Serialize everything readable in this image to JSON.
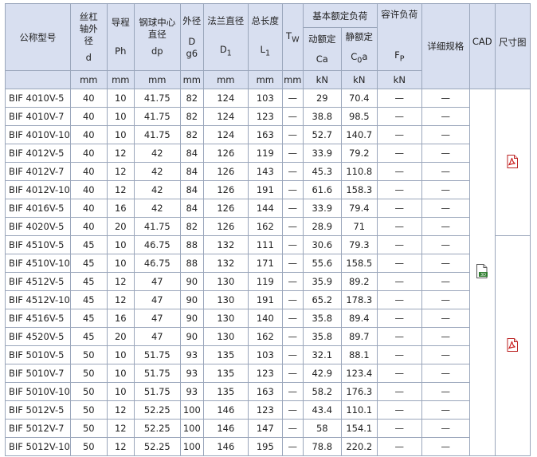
{
  "headers": {
    "model": "公称型号",
    "shaft_dia": "丝杠轴外径",
    "shaft_dia_sym": "d",
    "lead": "导程",
    "lead_sym": "Ph",
    "ball_center": "钢球中心直径",
    "ball_center_sym": "dp",
    "outer_dia": "外径",
    "outer_dia_sym_1": "D",
    "outer_dia_sym_2": "g6",
    "flange_dia": "法兰直径",
    "flange_dia_sym": "D",
    "flange_dia_sub": "1",
    "length": "总长度",
    "length_sym": "L",
    "length_sub": "1",
    "tw_sym": "T",
    "tw_sub": "W",
    "basic_load": "基本额定负荷",
    "dynamic": "动额定",
    "dynamic_sym": "Ca",
    "static": "静额定",
    "static_sym": "C",
    "static_sub": "0",
    "static_sym_tail": "a",
    "allow_load": "容许负荷",
    "allow_sym": "F",
    "allow_sub": "P",
    "detail": "详细规格",
    "cad": "CAD",
    "drawing": "尺寸图"
  },
  "units": [
    "mm",
    "mm",
    "mm",
    "mm",
    "mm",
    "mm",
    "mm",
    "kN",
    "kN",
    "kN"
  ],
  "rows": [
    {
      "model": "BIF 4010V-5",
      "d": "40",
      "ph": "10",
      "dp": "41.75",
      "D": "82",
      "D1": "124",
      "L1": "103",
      "tw": "—",
      "ca": "29",
      "c0a": "70.4",
      "fp": "—",
      "detail": "—"
    },
    {
      "model": "BIF 4010V-7",
      "d": "40",
      "ph": "10",
      "dp": "41.75",
      "D": "82",
      "D1": "124",
      "L1": "123",
      "tw": "—",
      "ca": "38.8",
      "c0a": "98.5",
      "fp": "—",
      "detail": "—"
    },
    {
      "model": "BIF 4010V-10",
      "d": "40",
      "ph": "10",
      "dp": "41.75",
      "D": "82",
      "D1": "124",
      "L1": "163",
      "tw": "—",
      "ca": "52.7",
      "c0a": "140.7",
      "fp": "—",
      "detail": "—"
    },
    {
      "model": "BIF 4012V-5",
      "d": "40",
      "ph": "12",
      "dp": "42",
      "D": "84",
      "D1": "126",
      "L1": "119",
      "tw": "—",
      "ca": "33.9",
      "c0a": "79.2",
      "fp": "—",
      "detail": "—"
    },
    {
      "model": "BIF 4012V-7",
      "d": "40",
      "ph": "12",
      "dp": "42",
      "D": "84",
      "D1": "126",
      "L1": "143",
      "tw": "—",
      "ca": "45.3",
      "c0a": "110.8",
      "fp": "—",
      "detail": "—"
    },
    {
      "model": "BIF 4012V-10",
      "d": "40",
      "ph": "12",
      "dp": "42",
      "D": "84",
      "D1": "126",
      "L1": "191",
      "tw": "—",
      "ca": "61.6",
      "c0a": "158.3",
      "fp": "—",
      "detail": "—"
    },
    {
      "model": "BIF 4016V-5",
      "d": "40",
      "ph": "16",
      "dp": "42",
      "D": "84",
      "D1": "126",
      "L1": "144",
      "tw": "—",
      "ca": "33.9",
      "c0a": "79.4",
      "fp": "—",
      "detail": "—"
    },
    {
      "model": "BIF 4020V-5",
      "d": "40",
      "ph": "20",
      "dp": "41.75",
      "D": "82",
      "D1": "126",
      "L1": "162",
      "tw": "—",
      "ca": "28.9",
      "c0a": "71",
      "fp": "—",
      "detail": "—"
    },
    {
      "model": "BIF 4510V-5",
      "d": "45",
      "ph": "10",
      "dp": "46.75",
      "D": "88",
      "D1": "132",
      "L1": "111",
      "tw": "—",
      "ca": "30.6",
      "c0a": "79.3",
      "fp": "—",
      "detail": "—"
    },
    {
      "model": "BIF 4510V-10",
      "d": "45",
      "ph": "10",
      "dp": "46.75",
      "D": "88",
      "D1": "132",
      "L1": "171",
      "tw": "—",
      "ca": "55.6",
      "c0a": "158.5",
      "fp": "—",
      "detail": "—"
    },
    {
      "model": "BIF 4512V-5",
      "d": "45",
      "ph": "12",
      "dp": "47",
      "D": "90",
      "D1": "130",
      "L1": "119",
      "tw": "—",
      "ca": "35.9",
      "c0a": "89.2",
      "fp": "—",
      "detail": "—"
    },
    {
      "model": "BIF 4512V-10",
      "d": "45",
      "ph": "12",
      "dp": "47",
      "D": "90",
      "D1": "130",
      "L1": "191",
      "tw": "—",
      "ca": "65.2",
      "c0a": "178.3",
      "fp": "—",
      "detail": "—"
    },
    {
      "model": "BIF 4516V-5",
      "d": "45",
      "ph": "16",
      "dp": "47",
      "D": "90",
      "D1": "130",
      "L1": "140",
      "tw": "—",
      "ca": "35.8",
      "c0a": "89.4",
      "fp": "—",
      "detail": "—"
    },
    {
      "model": "BIF 4520V-5",
      "d": "45",
      "ph": "20",
      "dp": "47",
      "D": "90",
      "D1": "130",
      "L1": "162",
      "tw": "—",
      "ca": "35.8",
      "c0a": "89.7",
      "fp": "—",
      "detail": "—"
    },
    {
      "model": "BIF 5010V-5",
      "d": "50",
      "ph": "10",
      "dp": "51.75",
      "D": "93",
      "D1": "135",
      "L1": "103",
      "tw": "—",
      "ca": "32.1",
      "c0a": "88.1",
      "fp": "—",
      "detail": "—"
    },
    {
      "model": "BIF 5010V-7",
      "d": "50",
      "ph": "10",
      "dp": "51.75",
      "D": "93",
      "D1": "135",
      "L1": "123",
      "tw": "—",
      "ca": "42.9",
      "c0a": "123.4",
      "fp": "—",
      "detail": "—"
    },
    {
      "model": "BIF 5010V-10",
      "d": "50",
      "ph": "10",
      "dp": "51.75",
      "D": "93",
      "D1": "135",
      "L1": "163",
      "tw": "—",
      "ca": "58.2",
      "c0a": "176.3",
      "fp": "—",
      "detail": "—"
    },
    {
      "model": "BIF 5012V-5",
      "d": "50",
      "ph": "12",
      "dp": "52.25",
      "D": "100",
      "D1": "146",
      "L1": "123",
      "tw": "—",
      "ca": "43.4",
      "c0a": "110.1",
      "fp": "—",
      "detail": "—"
    },
    {
      "model": "BIF 5012V-7",
      "d": "50",
      "ph": "12",
      "dp": "52.25",
      "D": "100",
      "D1": "146",
      "L1": "147",
      "tw": "—",
      "ca": "58",
      "c0a": "154.1",
      "fp": "—",
      "detail": "—"
    },
    {
      "model": "BIF 5012V-10",
      "d": "50",
      "ph": "12",
      "dp": "52.25",
      "D": "100",
      "D1": "146",
      "L1": "195",
      "tw": "—",
      "ca": "78.8",
      "c0a": "220.2",
      "fp": "—",
      "detail": "—"
    }
  ],
  "icons": {
    "cad": "3d-cad-file-icon",
    "drawing": "pdf-file-icon",
    "pdf_color": "#cc2222",
    "cad_badge_color": "#2f7d2f"
  },
  "colors": {
    "header_bg": "#d8dff0",
    "border": "#9aa6bb"
  }
}
